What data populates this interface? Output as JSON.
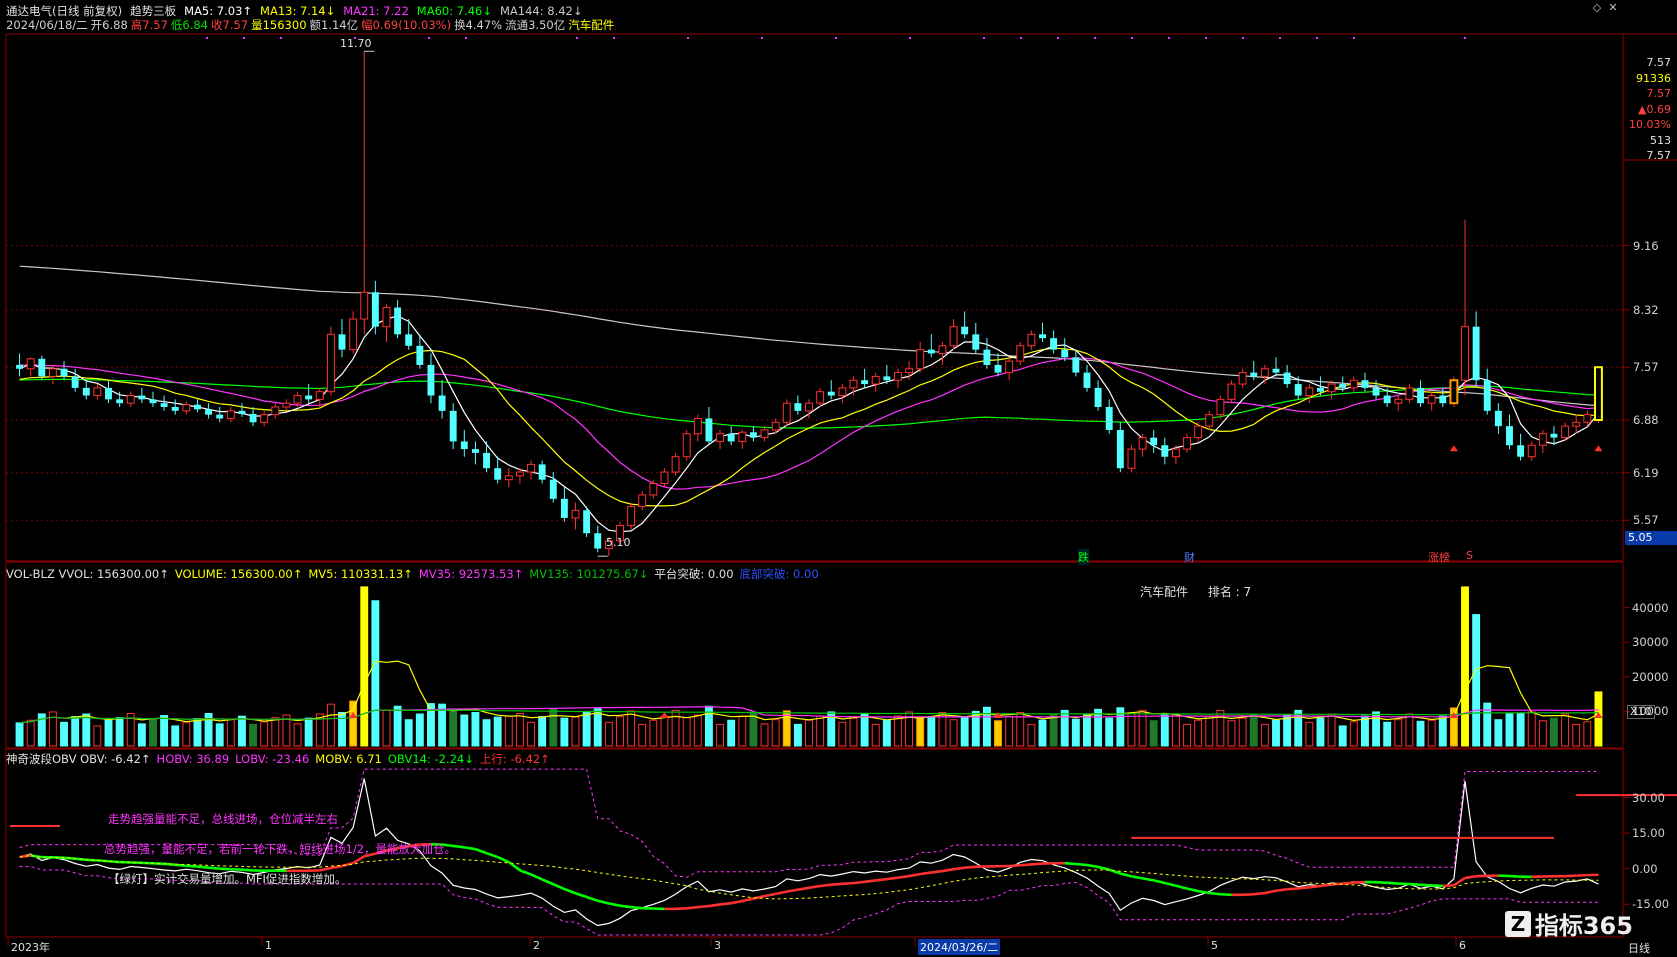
{
  "header": {
    "line1": [
      {
        "text": "通达电气(日线 前复权)",
        "color": "#e0e0e0"
      },
      {
        "text": "趋势三板",
        "color": "#e0e0e0"
      },
      {
        "text": "MA5: 7.03↑",
        "color": "#ffffff"
      },
      {
        "text": "MA13: 7.14↓",
        "color": "#ffff00"
      },
      {
        "text": "MA21: 7.22",
        "color": "#ff33ff"
      },
      {
        "text": "MA60: 7.46↓",
        "color": "#00ff00"
      },
      {
        "text": "MA144: 8.42↓",
        "color": "#c8c8c8"
      }
    ],
    "line2": [
      {
        "text": "2024/06/18/二",
        "color": "#d0d0d0"
      },
      {
        "text": "开6.88",
        "color": "#d0d0d0"
      },
      {
        "text": "高7.57",
        "color": "#ff4040"
      },
      {
        "text": "低6.84",
        "color": "#00e000"
      },
      {
        "text": "收7.57",
        "color": "#ff4040"
      },
      {
        "text": "量156300",
        "color": "#ffff00"
      },
      {
        "text": "额1.14亿",
        "color": "#d0d0d0"
      },
      {
        "text": "幅0.69(10.03%)",
        "color": "#ff4040"
      },
      {
        "text": "换4.47%",
        "color": "#d0d0d0"
      },
      {
        "text": "流通3.50亿",
        "color": "#d0d0d0"
      },
      {
        "text": "汽车配件",
        "color": "#ffff00"
      }
    ]
  },
  "window_buttons": {
    "restore": "◇",
    "close": "✕"
  },
  "price_axis": [
    "9.16",
    "8.32",
    "7.57",
    "6.88",
    "6.19",
    "5.57"
  ],
  "price_markers": {
    "high": "11.70",
    "low": "5.10"
  },
  "side_panel": [
    {
      "text": "7.57",
      "color": "#e0e0e0"
    },
    {
      "text": "91336",
      "color": "#ffff00"
    },
    {
      "text": "7.57",
      "color": "#ff4040"
    },
    {
      "text": "▲0.69",
      "color": "#ff4040"
    },
    {
      "text": "10.03%",
      "color": "#ff4040"
    },
    {
      "text": "513",
      "color": "#e0e0e0"
    },
    {
      "text": "7.57",
      "color": "#e0e0e0"
    }
  ],
  "current_price_box": "5.05",
  "event_labels": [
    {
      "text": "跌",
      "color": "#00ff00"
    },
    {
      "text": "财",
      "color": "#5080ff"
    },
    {
      "text": "涨榜",
      "color": "#ff4040"
    },
    {
      "text": "S",
      "color": "#ff4040"
    }
  ],
  "volume_header": [
    {
      "text": "VOL-BLZ VVOL: 156300.00↑",
      "color": "#e0e0e0"
    },
    {
      "text": "VOLUME: 156300.00↑",
      "color": "#ffff00"
    },
    {
      "text": "MV5: 110331.13↑",
      "color": "#ffff00"
    },
    {
      "text": "MV35: 92573.53↑",
      "color": "#ff33ff"
    },
    {
      "text": "MV135: 101275.67↓",
      "color": "#00c000"
    },
    {
      "text": "平台突破: 0.00",
      "color": "#e0e0e0"
    },
    {
      "text": "底部突破: 0.00",
      "color": "#3050ff"
    }
  ],
  "volume_note": {
    "sector": "汽车配件",
    "rank": "排名 : 7"
  },
  "volume_axis": [
    "40000",
    "30000",
    "20000",
    "10000"
  ],
  "volume_unit": "X10",
  "obv_header": [
    {
      "text": "神奇波段OBV OBV: -6.42↑",
      "color": "#e0e0e0"
    },
    {
      "text": "HOBV: 36.89",
      "color": "#ff33ff"
    },
    {
      "text": "LOBV: -23.46",
      "color": "#ff33ff"
    },
    {
      "text": "MOBV: 6.71",
      "color": "#ffff00"
    },
    {
      "text": "OBV14: -2.24↓",
      "color": "#00ff00"
    },
    {
      "text": "上行: -6.42↑",
      "color": "#ff3030"
    }
  ],
  "obv_axis": [
    "30.00",
    "15.00",
    "0.00",
    "-15.00"
  ],
  "obv_notes": [
    {
      "text": "走势趋强量能不足，总线进场，仓位减半左右",
      "color": "#ff33ff"
    },
    {
      "text": "总势趋强，量能不足，若前一轮下跌，短线进场1/2，量能放大加仓。",
      "color": "#ff33ff"
    },
    {
      "text": "【绿灯】实计交易量增加。MFI促进指数增加。",
      "color": "#e0e0e0"
    }
  ],
  "time_axis": [
    "2023年",
    "1",
    "2",
    "3",
    "2024/03/26/二",
    "5",
    "6"
  ],
  "bottom_right_label": "日线",
  "watermark": "指标365",
  "chart_data": {
    "type": "candlestick",
    "title": "通达电气(日线 前复权)",
    "ohlc_note": "daily OHLC, approximate, read from chart",
    "candles": [
      [
        7.6,
        7.75,
        7.45,
        7.55
      ],
      [
        7.55,
        7.7,
        7.45,
        7.68
      ],
      [
        7.68,
        7.72,
        7.4,
        7.45
      ],
      [
        7.45,
        7.6,
        7.35,
        7.55
      ],
      [
        7.55,
        7.65,
        7.4,
        7.45
      ],
      [
        7.45,
        7.55,
        7.25,
        7.3
      ],
      [
        7.3,
        7.4,
        7.15,
        7.2
      ],
      [
        7.2,
        7.35,
        7.15,
        7.3
      ],
      [
        7.3,
        7.4,
        7.1,
        7.15
      ],
      [
        7.15,
        7.25,
        7.05,
        7.1
      ],
      [
        7.1,
        7.25,
        7.05,
        7.2
      ],
      [
        7.2,
        7.3,
        7.1,
        7.15
      ],
      [
        7.15,
        7.25,
        7.05,
        7.1
      ],
      [
        7.1,
        7.2,
        7.0,
        7.05
      ],
      [
        7.05,
        7.15,
        6.95,
        7.0
      ],
      [
        7.0,
        7.12,
        6.95,
        7.08
      ],
      [
        7.08,
        7.15,
        6.98,
        7.02
      ],
      [
        7.02,
        7.1,
        6.9,
        6.95
      ],
      [
        6.95,
        7.05,
        6.85,
        6.9
      ],
      [
        6.9,
        7.05,
        6.85,
        7.0
      ],
      [
        7.0,
        7.1,
        6.92,
        6.96
      ],
      [
        6.96,
        7.05,
        6.8,
        6.85
      ],
      [
        6.85,
        7.0,
        6.8,
        6.95
      ],
      [
        6.95,
        7.1,
        6.9,
        7.05
      ],
      [
        7.05,
        7.15,
        7.0,
        7.1
      ],
      [
        7.1,
        7.25,
        7.05,
        7.2
      ],
      [
        7.2,
        7.35,
        7.1,
        7.15
      ],
      [
        7.15,
        7.3,
        7.05,
        7.25
      ],
      [
        7.25,
        8.1,
        7.2,
        8.0
      ],
      [
        8.0,
        8.2,
        7.7,
        7.8
      ],
      [
        7.8,
        8.3,
        7.75,
        8.2
      ],
      [
        8.2,
        11.7,
        8.0,
        8.55
      ],
      [
        8.55,
        8.7,
        8.0,
        8.1
      ],
      [
        8.1,
        8.4,
        7.9,
        8.35
      ],
      [
        8.35,
        8.45,
        7.95,
        8.0
      ],
      [
        8.0,
        8.2,
        7.8,
        7.85
      ],
      [
        7.85,
        8.0,
        7.55,
        7.6
      ],
      [
        7.6,
        7.75,
        7.1,
        7.2
      ],
      [
        7.2,
        7.4,
        6.9,
        7.0
      ],
      [
        7.0,
        7.1,
        6.5,
        6.6
      ],
      [
        6.6,
        6.75,
        6.4,
        6.5
      ],
      [
        6.5,
        6.6,
        6.3,
        6.45
      ],
      [
        6.45,
        6.6,
        6.2,
        6.25
      ],
      [
        6.25,
        6.4,
        6.05,
        6.1
      ],
      [
        6.1,
        6.25,
        6.0,
        6.15
      ],
      [
        6.15,
        6.25,
        6.05,
        6.2
      ],
      [
        6.2,
        6.35,
        6.1,
        6.3
      ],
      [
        6.3,
        6.35,
        6.05,
        6.1
      ],
      [
        6.1,
        6.2,
        5.8,
        5.85
      ],
      [
        5.85,
        6.0,
        5.55,
        5.6
      ],
      [
        5.6,
        5.8,
        5.45,
        5.7
      ],
      [
        5.7,
        5.75,
        5.35,
        5.4
      ],
      [
        5.4,
        5.5,
        5.15,
        5.2
      ],
      [
        5.2,
        5.35,
        5.1,
        5.3
      ],
      [
        5.3,
        5.55,
        5.25,
        5.5
      ],
      [
        5.5,
        5.8,
        5.45,
        5.75
      ],
      [
        5.75,
        5.95,
        5.7,
        5.9
      ],
      [
        5.9,
        6.1,
        5.85,
        6.05
      ],
      [
        6.05,
        6.25,
        6.0,
        6.2
      ],
      [
        6.2,
        6.45,
        6.15,
        6.4
      ],
      [
        6.4,
        6.75,
        6.35,
        6.7
      ],
      [
        6.7,
        6.95,
        6.6,
        6.9
      ],
      [
        6.9,
        7.05,
        6.55,
        6.6
      ],
      [
        6.6,
        6.75,
        6.5,
        6.7
      ],
      [
        6.7,
        6.8,
        6.55,
        6.6
      ],
      [
        6.6,
        6.75,
        6.5,
        6.72
      ],
      [
        6.72,
        6.8,
        6.6,
        6.65
      ],
      [
        6.65,
        6.8,
        6.6,
        6.75
      ],
      [
        6.75,
        6.9,
        6.7,
        6.85
      ],
      [
        6.85,
        7.15,
        6.8,
        7.1
      ],
      [
        7.1,
        7.2,
        6.95,
        7.0
      ],
      [
        7.0,
        7.15,
        6.9,
        7.1
      ],
      [
        7.1,
        7.3,
        7.05,
        7.25
      ],
      [
        7.25,
        7.4,
        7.15,
        7.2
      ],
      [
        7.2,
        7.35,
        7.1,
        7.3
      ],
      [
        7.3,
        7.45,
        7.2,
        7.4
      ],
      [
        7.4,
        7.55,
        7.3,
        7.35
      ],
      [
        7.35,
        7.5,
        7.25,
        7.45
      ],
      [
        7.45,
        7.6,
        7.35,
        7.4
      ],
      [
        7.4,
        7.55,
        7.3,
        7.5
      ],
      [
        7.5,
        7.65,
        7.4,
        7.55
      ],
      [
        7.55,
        7.9,
        7.5,
        7.8
      ],
      [
        7.8,
        8.0,
        7.7,
        7.75
      ],
      [
        7.75,
        7.9,
        7.6,
        7.85
      ],
      [
        7.85,
        8.2,
        7.8,
        8.1
      ],
      [
        8.1,
        8.3,
        7.95,
        8.0
      ],
      [
        8.0,
        8.15,
        7.75,
        7.8
      ],
      [
        7.8,
        7.95,
        7.55,
        7.6
      ],
      [
        7.6,
        7.75,
        7.45,
        7.5
      ],
      [
        7.5,
        7.7,
        7.4,
        7.65
      ],
      [
        7.65,
        7.9,
        7.6,
        7.85
      ],
      [
        7.85,
        8.05,
        7.8,
        8.0
      ],
      [
        8.0,
        8.15,
        7.9,
        7.95
      ],
      [
        7.95,
        8.05,
        7.75,
        7.8
      ],
      [
        7.8,
        7.95,
        7.65,
        7.7
      ],
      [
        7.7,
        7.8,
        7.45,
        7.5
      ],
      [
        7.5,
        7.6,
        7.25,
        7.3
      ],
      [
        7.3,
        7.4,
        7.0,
        7.05
      ],
      [
        7.05,
        7.15,
        6.7,
        6.75
      ],
      [
        6.75,
        6.85,
        6.2,
        6.25
      ],
      [
        6.25,
        6.55,
        6.2,
        6.5
      ],
      [
        6.5,
        6.7,
        6.4,
        6.65
      ],
      [
        6.65,
        6.75,
        6.45,
        6.55
      ],
      [
        6.55,
        6.65,
        6.3,
        6.4
      ],
      [
        6.4,
        6.55,
        6.3,
        6.5
      ],
      [
        6.5,
        6.7,
        6.45,
        6.65
      ],
      [
        6.65,
        6.85,
        6.6,
        6.8
      ],
      [
        6.8,
        7.0,
        6.75,
        6.95
      ],
      [
        6.95,
        7.2,
        6.9,
        7.15
      ],
      [
        7.15,
        7.4,
        7.1,
        7.35
      ],
      [
        7.35,
        7.55,
        7.3,
        7.5
      ],
      [
        7.5,
        7.65,
        7.4,
        7.45
      ],
      [
        7.45,
        7.6,
        7.35,
        7.55
      ],
      [
        7.55,
        7.7,
        7.45,
        7.5
      ],
      [
        7.5,
        7.6,
        7.3,
        7.35
      ],
      [
        7.35,
        7.45,
        7.15,
        7.2
      ],
      [
        7.2,
        7.35,
        7.1,
        7.3
      ],
      [
        7.3,
        7.45,
        7.2,
        7.25
      ],
      [
        7.25,
        7.4,
        7.15,
        7.35
      ],
      [
        7.35,
        7.45,
        7.25,
        7.3
      ],
      [
        7.3,
        7.45,
        7.25,
        7.4
      ],
      [
        7.4,
        7.5,
        7.25,
        7.3
      ],
      [
        7.3,
        7.4,
        7.15,
        7.2
      ],
      [
        7.2,
        7.3,
        7.05,
        7.1
      ],
      [
        7.1,
        7.2,
        7.0,
        7.15
      ],
      [
        7.15,
        7.35,
        7.1,
        7.3
      ],
      [
        7.3,
        7.4,
        7.05,
        7.1
      ],
      [
        7.1,
        7.25,
        7.0,
        7.2
      ],
      [
        7.2,
        7.3,
        7.05,
        7.1
      ],
      [
        7.1,
        7.45,
        7.05,
        7.4
      ],
      [
        7.4,
        9.5,
        7.2,
        8.1
      ],
      [
        8.1,
        8.3,
        7.3,
        7.4
      ],
      [
        7.4,
        7.55,
        6.95,
        7.0
      ],
      [
        7.0,
        7.1,
        6.7,
        6.8
      ],
      [
        6.8,
        6.95,
        6.5,
        6.55
      ],
      [
        6.55,
        6.7,
        6.35,
        6.4
      ],
      [
        6.4,
        6.6,
        6.35,
        6.55
      ],
      [
        6.55,
        6.75,
        6.45,
        6.7
      ],
      [
        6.7,
        6.8,
        6.55,
        6.65
      ],
      [
        6.65,
        6.85,
        6.6,
        6.8
      ],
      [
        6.8,
        6.95,
        6.7,
        6.85
      ],
      [
        6.85,
        7.0,
        6.8,
        6.95
      ],
      [
        6.88,
        7.57,
        6.84,
        7.57
      ]
    ],
    "moving_averages": [
      {
        "name": "MA5",
        "color": "#ffffff",
        "value": 7.03
      },
      {
        "name": "MA13",
        "color": "#ffff00",
        "value": 7.14
      },
      {
        "name": "MA21",
        "color": "#ff33ff",
        "value": 7.22
      },
      {
        "name": "MA60",
        "color": "#00ff00",
        "value": 7.46
      },
      {
        "name": "MA144",
        "color": "#c8c8c8",
        "value": 8.42
      }
    ],
    "price_range": [
      5.05,
      11.9
    ],
    "volume": {
      "last": 156300,
      "MV5": 110331.13,
      "MV35": 92573.53,
      "MV135": 101275.67,
      "ylim": [
        0,
        48000
      ]
    },
    "obv": {
      "OBV": -6.42,
      "HOBV": 36.89,
      "LOBV": -23.46,
      "MOBV": 6.71,
      "OBV14": -2.24,
      "ylim": [
        -28,
        45
      ]
    }
  }
}
